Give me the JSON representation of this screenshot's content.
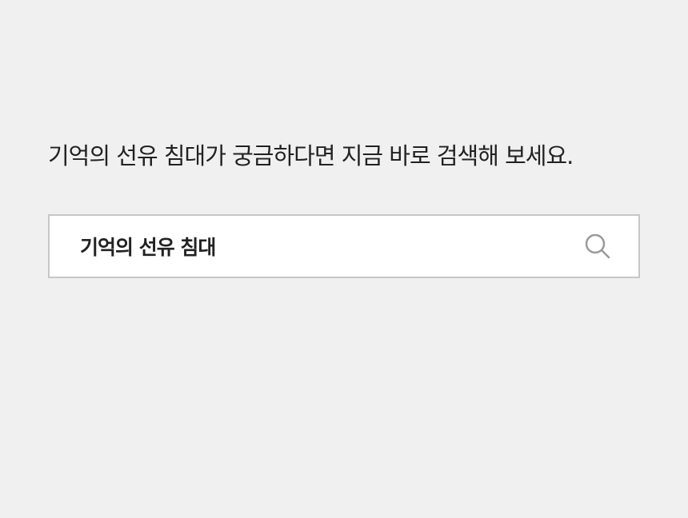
{
  "headline": "기억의 선유 침대가 궁금하다면 지금 바로 검색해 보세요.",
  "search": {
    "value": "기억의 선유 침대",
    "icon": "search-icon"
  },
  "colors": {
    "background": "#f0f0f0",
    "text": "#222222",
    "border": "#c7c7c7",
    "icon": "#9a9a9a"
  }
}
